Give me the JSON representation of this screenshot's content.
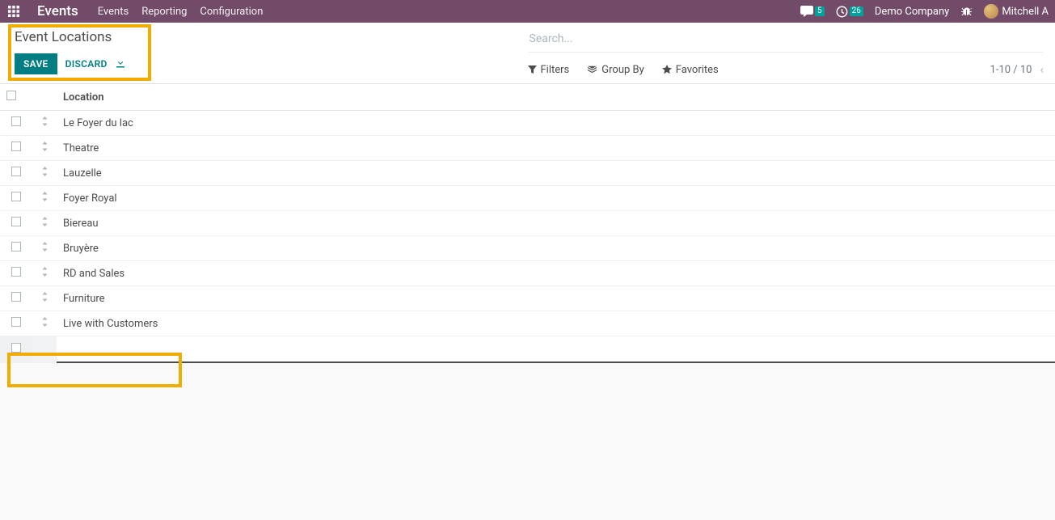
{
  "topbar": {
    "brand": "Events",
    "menu": [
      "Events",
      "Reporting",
      "Configuration"
    ],
    "messages_count": "5",
    "activities_count": "26",
    "company": "Demo Company",
    "user_name": "Mitchell A"
  },
  "breadcrumb": "Event Locations",
  "buttons": {
    "save": "SAVE",
    "discard": "DISCARD"
  },
  "search": {
    "placeholder": "Search..."
  },
  "toolbar": {
    "filters": "Filters",
    "group_by": "Group By",
    "favorites": "Favorites"
  },
  "pager": {
    "range": "1-10 / 10"
  },
  "table": {
    "header_location": "Location",
    "rows": [
      {
        "location": "Le Foyer du lac"
      },
      {
        "location": "Theatre"
      },
      {
        "location": "Lauzelle"
      },
      {
        "location": "Foyer Royal"
      },
      {
        "location": "Biereau"
      },
      {
        "location": "Bruyère"
      },
      {
        "location": "RD and Sales"
      },
      {
        "location": "Furniture"
      },
      {
        "location": "Live with Customers"
      }
    ],
    "new_row_value": ""
  }
}
